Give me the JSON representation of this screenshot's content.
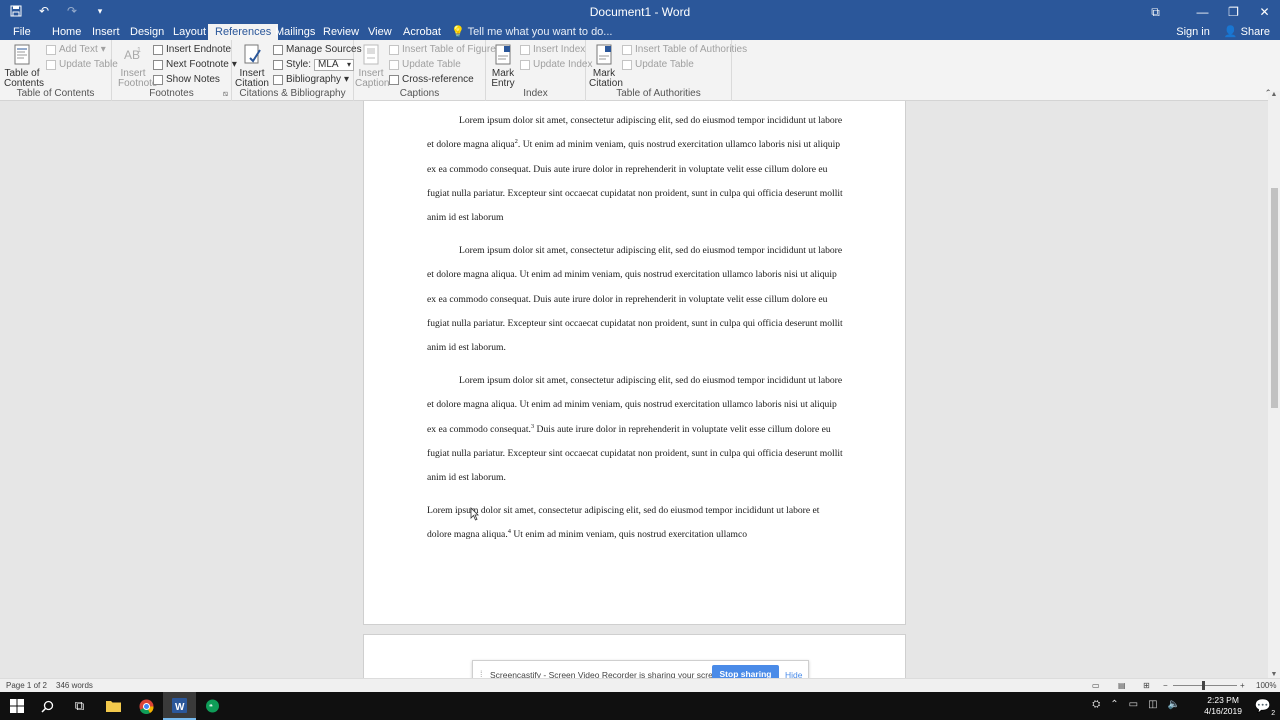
{
  "window": {
    "title": "Document1 - Word"
  },
  "qat_icons": [
    "save-icon",
    "undo-icon",
    "redo-icon",
    "customize-icon"
  ],
  "tabs": [
    "File",
    "Home",
    "Insert",
    "Design",
    "Layout",
    "References",
    "Mailings",
    "Review",
    "View",
    "Acrobat"
  ],
  "active_tab": "References",
  "tell_me": "Tell me what you want to do...",
  "sign_in": "Sign in",
  "share": "Share",
  "ribbon": {
    "toc": {
      "label": "Table of Contents",
      "big": "Table of Contents",
      "add_text": "Add Text",
      "update_table": "Update Table"
    },
    "footnotes": {
      "label": "Footnotes",
      "insert_footnote": "Insert Footnote",
      "insert_endnote": "Insert Endnote",
      "next_footnote": "Next Footnote",
      "show_notes": "Show Notes"
    },
    "citations": {
      "label": "Citations & Bibliography",
      "insert_citation": "Insert Citation",
      "manage_sources": "Manage Sources",
      "style_label": "Style:",
      "style_value": "MLA",
      "bibliography": "Bibliography"
    },
    "captions": {
      "label": "Captions",
      "insert_caption": "Insert Caption",
      "insert_tof": "Insert Table of Figures",
      "update_table": "Update Table",
      "cross_reference": "Cross-reference"
    },
    "index": {
      "label": "Index",
      "mark_entry": "Mark Entry",
      "insert_index": "Insert Index",
      "update_index": "Update Index"
    },
    "toa": {
      "label": "Table of Authorities",
      "mark_citation": "Mark Citation",
      "insert_toa": "Insert Table of Authorities",
      "update_table": "Update Table"
    }
  },
  "document": {
    "paragraphs": [
      {
        "before": "Lorem ipsum dolor sit amet, consectetur adipiscing elit, sed do eiusmod tempor incididunt ut labore et dolore magna aliqua",
        "sup": "2",
        "after": ". Ut enim ad minim veniam, quis nostrud exercitation ullamco laboris nisi ut aliquip ex ea commodo consequat. Duis aute irure dolor in reprehenderit in voluptate velit esse cillum dolore eu fugiat nulla pariatur. Excepteur sint occaecat cupidatat non proident, sunt in culpa qui officia deserunt mollit anim id est laborum"
      },
      {
        "before": "Lorem ipsum dolor sit amet, consectetur adipiscing elit, sed do eiusmod tempor incididunt ut labore et dolore magna aliqua. Ut enim ad minim veniam, quis nostrud exercitation ullamco laboris nisi ut aliquip ex ea commodo consequat. Duis aute irure dolor in reprehenderit in voluptate velit esse cillum dolore eu fugiat nulla pariatur. Excepteur sint occaecat cupidatat non proident, sunt in culpa qui officia deserunt mollit anim id est laborum.",
        "sup": "",
        "after": ""
      },
      {
        "before": "Lorem ipsum dolor sit amet, consectetur adipiscing elit, sed do eiusmod tempor incididunt ut labore et dolore magna aliqua. Ut enim ad minim veniam, quis nostrud exercitation ullamco laboris nisi ut aliquip ex ea commodo consequat.",
        "sup": "3",
        "after": " Duis aute irure dolor in reprehenderit in voluptate velit esse cillum dolore eu fugiat nulla pariatur. Excepteur sint occaecat cupidatat non proident, sunt in culpa qui officia deserunt mollit anim id est laborum."
      },
      {
        "before": "Lorem ipsum dolor sit amet, consectetur adipiscing elit, sed do eiusmod tempor incididunt ut labore et dolore magna aliqua.",
        "sup": "4",
        "after": " Ut enim ad minim veniam, quis nostrud exercitation ullamco"
      }
    ]
  },
  "sharebar": {
    "message": "Screencastify - Screen Video Recorder is sharing your screen.",
    "stop": "Stop sharing",
    "hide": "Hide"
  },
  "status": {
    "page": "Page 1 of 2",
    "words": "346 words",
    "zoom": "100%"
  },
  "taskbar": {
    "time": "2:23 PM",
    "date": "4/16/2019",
    "notifications": "2"
  }
}
